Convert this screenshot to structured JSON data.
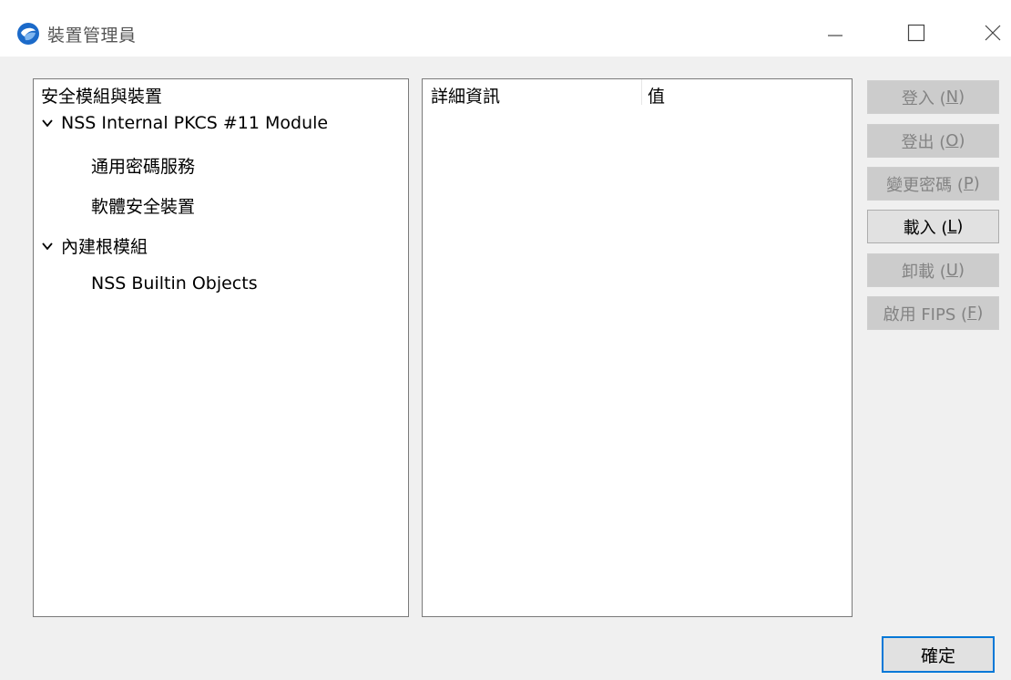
{
  "window": {
    "title": "裝置管理員",
    "app_icon": "thunderbird-icon"
  },
  "tree": {
    "header": "安全模組與裝置",
    "nodes": [
      {
        "label": "NSS Internal PKCS #11 Module",
        "expanded": true,
        "level": 0
      },
      {
        "label": "通用密碼服務",
        "level": 1
      },
      {
        "label": "軟體安全裝置",
        "level": 1
      },
      {
        "label": "內建根模組",
        "expanded": true,
        "level": 0
      },
      {
        "label": "NSS Builtin Objects",
        "level": 1
      }
    ]
  },
  "details": {
    "columns": [
      "詳細資訊",
      "值"
    ]
  },
  "buttons": {
    "login": {
      "text": "登入 (",
      "key": "N",
      "tail": ")",
      "enabled": false
    },
    "logout": {
      "text": "登出 (",
      "key": "O",
      "tail": ")",
      "enabled": false
    },
    "change_password": {
      "text": "變更密碼 (",
      "key": "P",
      "tail": ")",
      "enabled": false
    },
    "load": {
      "text": "載入 (",
      "key": "L",
      "tail": ")",
      "enabled": true
    },
    "unload": {
      "text": "卸載 (",
      "key": "U",
      "tail": ")",
      "enabled": false
    },
    "enable_fips": {
      "text": "啟用 FIPS (",
      "key": "F",
      "tail": ")",
      "enabled": false
    },
    "ok": "確定"
  },
  "colors": {
    "disabled_button_bg": "#cccccc",
    "disabled_text": "#838383",
    "focus_border": "#0078d7"
  }
}
